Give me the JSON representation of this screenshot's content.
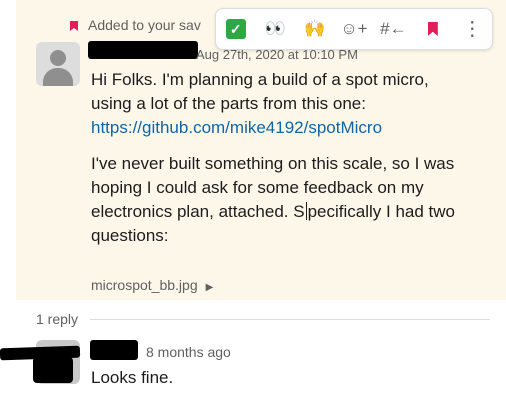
{
  "message": {
    "saved_label": "Added to your sav",
    "timestamp": "Aug 27th, 2020 at 10:10 PM",
    "paragraph1_line1": "Hi Folks. I'm planning a build of a spot micro,",
    "paragraph1_line2": "using a lot of the parts from this one:",
    "link": "https://github.com/mike4192/spotMicro",
    "paragraph2_before_cursor": "I've never built something on this scale, so I was hoping I could ask for some feedback on my electronics plan, attached. S",
    "paragraph2_after_cursor": "pecifically I had two questions:",
    "attachment_name": "microspot_bb.jpg"
  },
  "toolbar": {
    "items": [
      {
        "name": "check-mark-reaction-icon",
        "glyph": "✓"
      },
      {
        "name": "eyes-reaction-icon",
        "glyph": "👀"
      },
      {
        "name": "raised-hands-reaction-icon",
        "glyph": "🙌"
      },
      {
        "name": "add-reaction-icon",
        "glyph": "☺+"
      },
      {
        "name": "reply-in-thread-icon",
        "glyph": "#←"
      },
      {
        "name": "bookmark-icon",
        "glyph": ""
      },
      {
        "name": "more-actions-icon",
        "glyph": "⋮"
      }
    ]
  },
  "thread": {
    "reply_count": "1 reply",
    "reply_time": "8 months ago",
    "reply_text": "Looks fine."
  }
}
